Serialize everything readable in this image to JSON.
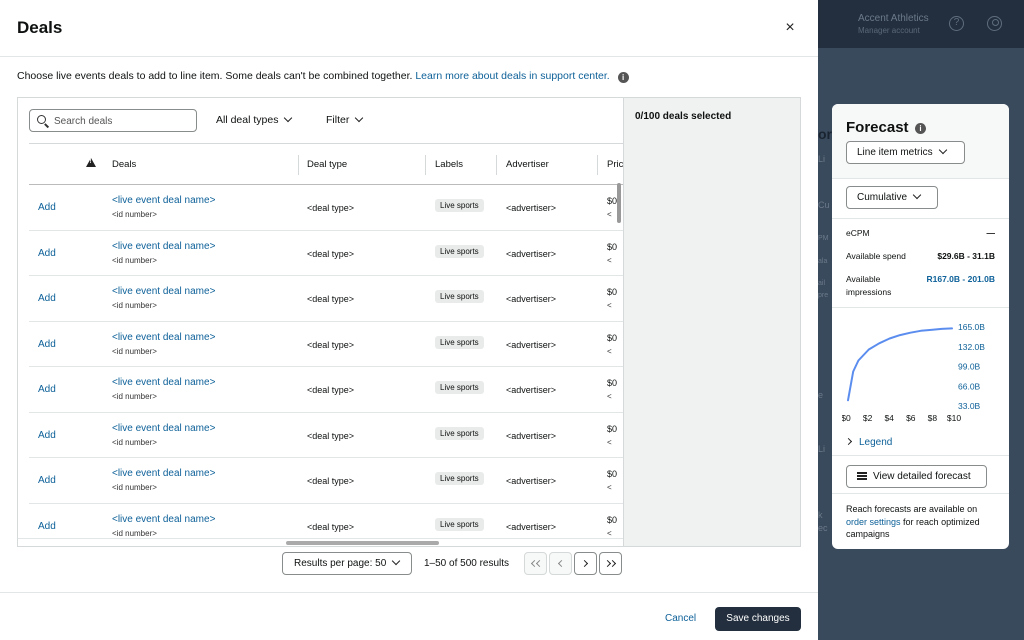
{
  "modal": {
    "title": "Deals",
    "close_icon": "×",
    "intro_text": "Choose live events deals to add to line item. Some deals can't be combined together.",
    "intro_link": "Learn more about deals in support center.",
    "info_icon": "i",
    "search": {
      "placeholder": "Search deals"
    },
    "deal_types_dropdown": "All deal types",
    "filter_dropdown": "Filter",
    "columns": [
      "Deals",
      "Deal type",
      "Labels",
      "Advertiser",
      "Pric"
    ],
    "rows": [
      {
        "action": "Add",
        "name": "<live event deal name>",
        "id": "<id number>",
        "type": "<deal type>",
        "label": "Live sports",
        "advertiser": "<advertiser>",
        "price": "$0",
        "price_sub": "<"
      },
      {
        "action": "Add",
        "name": "<live event deal name>",
        "id": "<id number>",
        "type": "<deal type>",
        "label": "Live sports",
        "advertiser": "<advertiser>",
        "price": "$0",
        "price_sub": "<"
      },
      {
        "action": "Add",
        "name": "<live event deal name>",
        "id": "<id number>",
        "type": "<deal type>",
        "label": "Live sports",
        "advertiser": "<advertiser>",
        "price": "$0",
        "price_sub": "<"
      },
      {
        "action": "Add",
        "name": "<live event deal name>",
        "id": "<id number>",
        "type": "<deal type>",
        "label": "Live sports",
        "advertiser": "<advertiser>",
        "price": "$0",
        "price_sub": "<"
      },
      {
        "action": "Add",
        "name": "<live event deal name>",
        "id": "<id number>",
        "type": "<deal type>",
        "label": "Live sports",
        "advertiser": "<advertiser>",
        "price": "$0",
        "price_sub": "<"
      },
      {
        "action": "Add",
        "name": "<live event deal name>",
        "id": "<id number>",
        "type": "<deal type>",
        "label": "Live sports",
        "advertiser": "<advertiser>",
        "price": "$0",
        "price_sub": "<"
      },
      {
        "action": "Add",
        "name": "<live event deal name>",
        "id": "<id number>",
        "type": "<deal type>",
        "label": "Live sports",
        "advertiser": "<advertiser>",
        "price": "$0",
        "price_sub": "<"
      },
      {
        "action": "Add",
        "name": "<live event deal name>",
        "id": "<id number>",
        "type": "<deal type>",
        "label": "Live sports",
        "advertiser": "<advertiser>",
        "price": "$0",
        "price_sub": "<"
      }
    ],
    "selected_count": "0/100 deals selected",
    "pagination": {
      "results_per_page": "Results per page: 50",
      "results_text": "1–50 of 500 results"
    },
    "cancel_label": "Cancel",
    "save_label": "Save changes"
  },
  "background": {
    "account_name": "Accent Athletics",
    "account_sub": "Manager account",
    "help_icon": "?",
    "ghost_fragments": [
      "or",
      "Li",
      "Cu",
      "PM",
      "ala",
      "ail",
      "pre",
      "e",
      "Li",
      "",
      "k",
      "ec"
    ]
  },
  "forecast": {
    "title": "Forecast",
    "info_icon": "i",
    "metrics_dropdown": "Line item metrics",
    "mode_dropdown": "Cumulative",
    "metrics": [
      {
        "label": "eCPM",
        "value": "—"
      },
      {
        "label": "Available spend",
        "value": "$29.6B - 31.1B"
      },
      {
        "label": "Available impressions",
        "value": "R167.0B - 201.0B"
      }
    ],
    "legend_label": "Legend",
    "detailed_button": "View detailed forecast",
    "reach_text_1": "Reach forecasts are available on",
    "reach_link": "order settings",
    "reach_text_2": "for reach optimized campaigns",
    "accent_color": "#5b8def"
  },
  "chart_data": {
    "type": "line",
    "title": "",
    "xlabel": "",
    "ylabel": "",
    "x_ticks": [
      "$0",
      "$2",
      "$4",
      "$6",
      "$8",
      "$10"
    ],
    "y_ticks": [
      "165.0B",
      "132.0B",
      "99.0B",
      "66.0B",
      "33.0B"
    ],
    "xlim": [
      0,
      10
    ],
    "ylim": [
      0,
      165
    ],
    "series": [
      {
        "x": [
          0,
          0.5,
          1,
          2,
          3,
          4,
          5,
          6,
          7,
          8,
          9,
          10
        ],
        "y": [
          12,
          72,
          95,
          118,
          131,
          141,
          148,
          153,
          157,
          159,
          161,
          162
        ]
      }
    ]
  }
}
